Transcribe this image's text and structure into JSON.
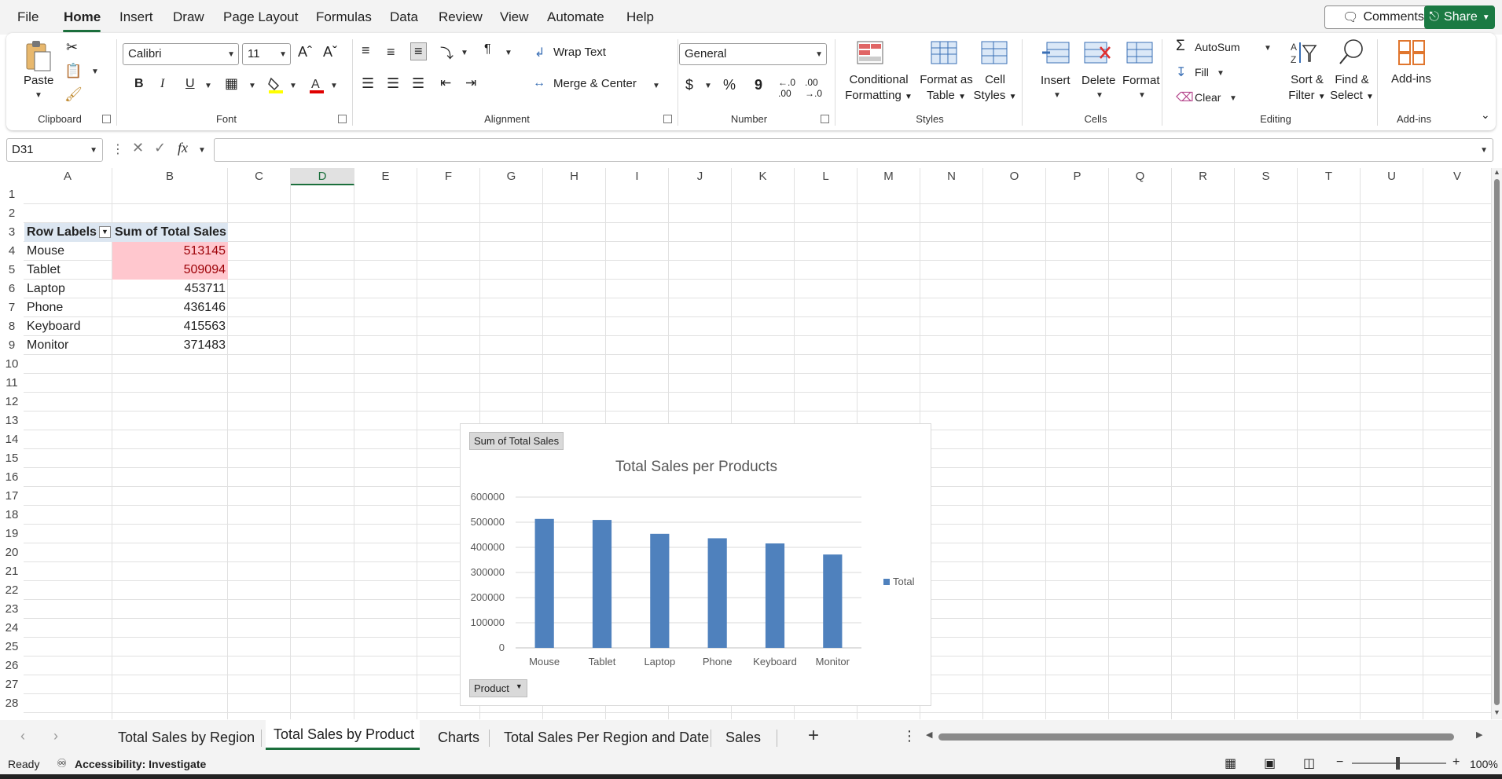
{
  "menu": {
    "tabs": [
      "File",
      "Home",
      "Insert",
      "Draw",
      "Page Layout",
      "Formulas",
      "Data",
      "Review",
      "View",
      "Automate",
      "Help"
    ],
    "active": "Home",
    "comments_label": "Comments",
    "share_label": "Share"
  },
  "ribbon": {
    "clipboard": {
      "paste": "Paste",
      "group": "Clipboard"
    },
    "font": {
      "name": "Calibri",
      "size": "11",
      "group": "Font",
      "bold": "B",
      "italic": "I",
      "underline": "U"
    },
    "alignment": {
      "wrap": "Wrap Text",
      "merge": "Merge & Center",
      "group": "Alignment"
    },
    "number": {
      "format": "General",
      "currency": "$",
      "percent": "%",
      "comma": "9",
      "group": "Number"
    },
    "styles": {
      "conditional": [
        "Conditional",
        "Formatting"
      ],
      "format_table": [
        "Format as",
        "Table"
      ],
      "cell_styles": [
        "Cell",
        "Styles"
      ],
      "group": "Styles"
    },
    "cells": {
      "insert": "Insert",
      "delete": "Delete",
      "format": "Format",
      "group": "Cells"
    },
    "editing": {
      "autosum": "AutoSum",
      "fill": "Fill",
      "clear": "Clear",
      "sort": [
        "Sort &",
        "Filter"
      ],
      "find": [
        "Find &",
        "Select"
      ],
      "group": "Editing"
    },
    "addins": {
      "label": "Add-ins",
      "group": "Add-ins"
    }
  },
  "formula_bar": {
    "name_box": "D31",
    "fx": "fx",
    "value": ""
  },
  "columns": [
    "A",
    "B",
    "C",
    "D",
    "E",
    "F",
    "G",
    "H",
    "I",
    "J",
    "K",
    "L",
    "M",
    "N",
    "O",
    "P",
    "Q",
    "R",
    "S",
    "T",
    "U",
    "V"
  ],
  "selected_column": "D",
  "rows": [
    "1",
    "2",
    "3",
    "4",
    "5",
    "6",
    "7",
    "8",
    "9",
    "10",
    "11",
    "12",
    "13",
    "14",
    "15",
    "16",
    "17",
    "18",
    "19",
    "20",
    "21",
    "22",
    "23",
    "24",
    "25",
    "26",
    "27",
    "28"
  ],
  "pivot": {
    "header_labels": "Row Labels",
    "header_values": "Sum of Total Sales",
    "rows": [
      {
        "label": "Mouse",
        "value": "513145"
      },
      {
        "label": "Tablet",
        "value": "509094"
      },
      {
        "label": "Laptop",
        "value": "453711"
      },
      {
        "label": "Phone",
        "value": "436146"
      },
      {
        "label": "Keyboard",
        "value": "415563"
      },
      {
        "label": "Monitor",
        "value": "371483"
      }
    ]
  },
  "chart_field_buttons": {
    "value_field": "Sum of Total Sales",
    "axis_field": "Product"
  },
  "chart_data": {
    "type": "bar",
    "title": "Total Sales per Products",
    "categories": [
      "Mouse",
      "Tablet",
      "Laptop",
      "Phone",
      "Keyboard",
      "Monitor"
    ],
    "series": [
      {
        "name": "Total",
        "values": [
          513145,
          509094,
          453711,
          436146,
          415563,
          371483
        ]
      }
    ],
    "ylim": [
      0,
      600000
    ],
    "yticks": [
      "0",
      "100000",
      "200000",
      "300000",
      "400000",
      "500000",
      "600000"
    ],
    "legend": "right",
    "grid": true,
    "color": "#4f81bd"
  },
  "sheet_tabs": [
    "Total Sales by Region",
    "Total Sales by Product",
    "Charts",
    "Total Sales Per Region and Date",
    "Sales"
  ],
  "active_sheet": "Total Sales by Product",
  "status": {
    "ready": "Ready",
    "accessibility": "Accessibility: Investigate",
    "zoom": "100%"
  }
}
